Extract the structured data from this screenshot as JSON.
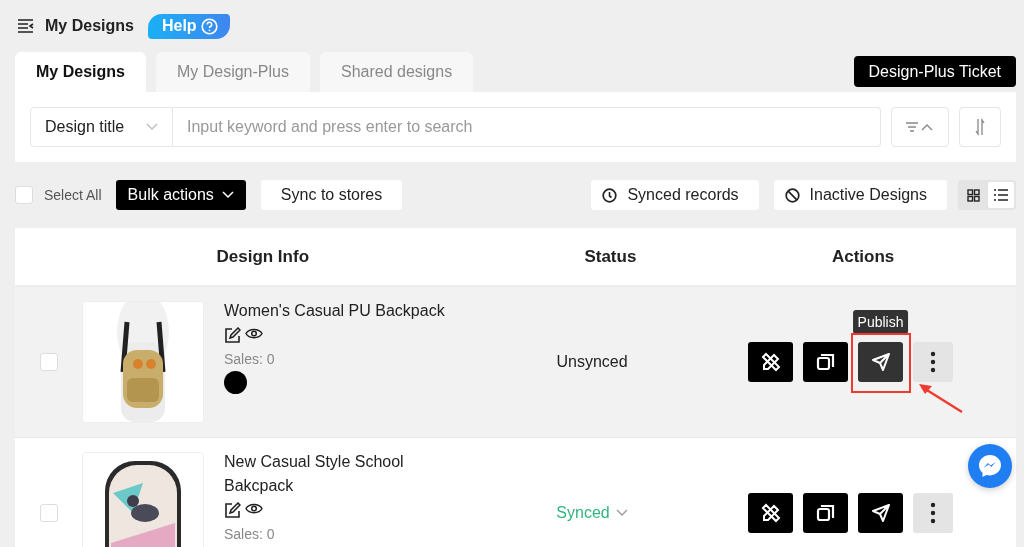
{
  "header": {
    "title": "My Designs",
    "help": "Help"
  },
  "tabs": [
    {
      "label": "My Designs",
      "selected": true
    },
    {
      "label": "My Design-Plus",
      "selected": false
    },
    {
      "label": "Shared designs",
      "selected": false
    }
  ],
  "ticket_button": "Design-Plus Ticket",
  "search": {
    "field_select": "Design title",
    "placeholder": "Input keyword and press enter to search"
  },
  "toolbar": {
    "select_all": {
      "label": "Select All",
      "checked": false
    },
    "bulk": "Bulk actions",
    "sync": "Sync to stores",
    "synced_records": "Synced records",
    "inactive": "Inactive Designs",
    "views": [
      {
        "kind": "grid",
        "selected": false
      },
      {
        "kind": "list",
        "selected": true
      }
    ]
  },
  "table": {
    "columns": [
      "Design Info",
      "Status",
      "Actions"
    ],
    "rows": [
      {
        "title": "Women's Casual PU Backpack",
        "sales": "Sales: 0",
        "colors": [
          {
            "color": "#000000"
          }
        ],
        "status": {
          "kind": "unsynced",
          "label": "Unsynced"
        },
        "checked": false,
        "hovered": true,
        "picture": {
          "kind": "picture"
        },
        "actions": [
          {
            "kind": "design",
            "hovered": false
          },
          {
            "kind": "copy",
            "hovered": false
          },
          {
            "kind": "publish",
            "hovered": true,
            "tooltip": "Publish",
            "annotated": true
          },
          {
            "kind": "more",
            "hovered": false
          }
        ]
      },
      {
        "title": "New Casual Style School Bakcpack",
        "sales": "Sales: 0",
        "colors": [],
        "status": {
          "kind": "synced",
          "label": "Synced"
        },
        "checked": false,
        "hovered": false,
        "picture": {
          "kind": "picture"
        },
        "actions": [
          {
            "kind": "design",
            "hovered": false
          },
          {
            "kind": "copy",
            "hovered": false
          },
          {
            "kind": "publish",
            "hovered": false
          },
          {
            "kind": "more",
            "hovered": false
          }
        ]
      }
    ]
  }
}
